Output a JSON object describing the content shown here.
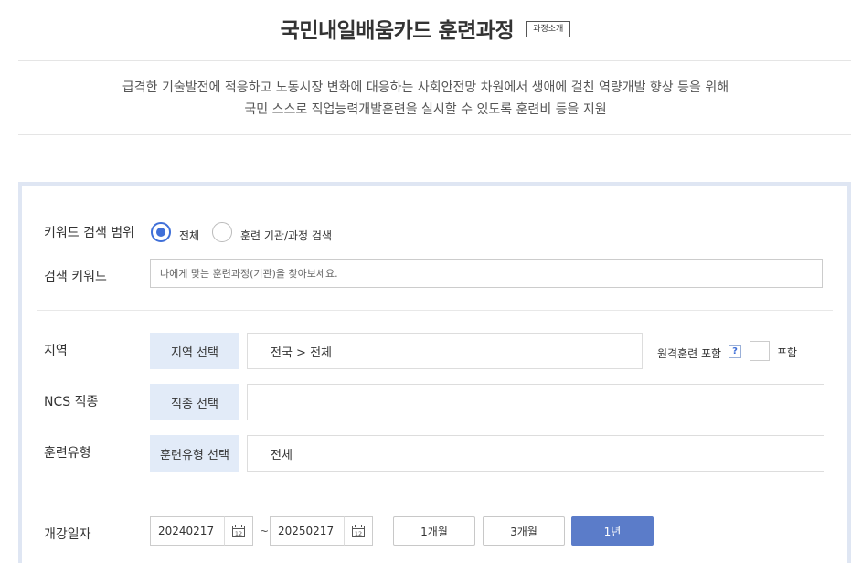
{
  "header": {
    "title": "국민내일배움카드 훈련과정",
    "intro_button": "과정소개",
    "desc_line1": "급격한 기술발전에 적응하고 노동시장 변화에 대응하는 사회안전망 차원에서 생애에 걸친 역량개발 향상 등을 위해",
    "desc_line2": "국민 스스로 직업능력개발훈련을 실시할 수 있도록 훈련비 등을 지원"
  },
  "search": {
    "scope_label": "키워드 검색 범위",
    "scope_options": [
      {
        "label": "전체",
        "selected": true
      },
      {
        "label": "훈련 기관/과정 검색",
        "selected": false
      }
    ],
    "keyword_label": "검색 키워드",
    "keyword_placeholder": "나에게 맞는 훈련과정(기관)을 찾아보세요.",
    "keyword_value": ""
  },
  "filters": {
    "region": {
      "label": "지역",
      "button": "지역 선택",
      "value": "전국 > 전체",
      "remote_label": "원격훈련 포함",
      "help": "?",
      "include_label": "포함",
      "include_checked": false
    },
    "ncs": {
      "label": "NCS 직종",
      "button": "직종 선택",
      "value": ""
    },
    "training_type": {
      "label": "훈련유형",
      "button": "훈련유형 선택",
      "value": "전체"
    }
  },
  "dates": {
    "label": "개강일자",
    "start": "20240217",
    "end": "20250217",
    "separator": "~",
    "periods": [
      {
        "label": "1개월",
        "active": false
      },
      {
        "label": "3개월",
        "active": false
      },
      {
        "label": "1년",
        "active": true
      }
    ]
  },
  "colors": {
    "accent": "#3f6fd8",
    "active_button": "#5b7cc9",
    "select_button_bg": "#e2ebf8",
    "panel_border": "#dfe6f3"
  }
}
